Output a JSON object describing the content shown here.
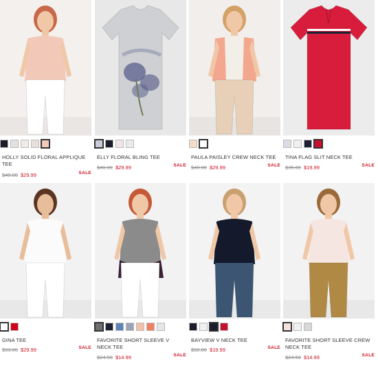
{
  "products": [
    {
      "name": "HOLLY SOLID FLORAL APPLIQUE TEE",
      "old_price": "$40.00",
      "price": "$29.99",
      "sale": "SALE",
      "swatches": [
        "#1c1c2a",
        "#e2e2e2",
        "#f0ebe6",
        "#e9e0db",
        "#f2c9b8"
      ],
      "selected_swatch": 4,
      "colors": {
        "bg": "#f3f0ee",
        "top": "#f2c9b8",
        "bottom": "#ffffff",
        "skin": "#f0c8a8",
        "hair": "#c8684a"
      }
    },
    {
      "name": "ELLY FLORAL BLING TEE",
      "old_price": "$40.00",
      "price": "$29.99",
      "sale": "SALE",
      "swatches": [
        "#c9ccd8",
        "#1c1c2a",
        "#f2e4e4",
        "#ebebeb"
      ],
      "selected_swatch": 0,
      "colors": {
        "bg": "#e8e8e8",
        "top": "#cfd0d3",
        "bottom": "#cfd0d3",
        "skin": "#cfd0d3",
        "hair": "#cfd0d3",
        "print": "#5a5f8c"
      }
    },
    {
      "name": "PAULA PAISLEY CREW NECK TEE",
      "old_price": "$40.00",
      "price": "$29.99",
      "sale": "SALE",
      "swatches": [
        "#f4ddca",
        "#ffffff"
      ],
      "selected_swatch": 1,
      "colors": {
        "bg": "#f1eeec",
        "top": "#f2efe9",
        "bottom": "#e7cfb8",
        "skin": "#f0c8a8",
        "hair": "#d3a266",
        "cardigan": "#f3a78f"
      }
    },
    {
      "name": "TINA FLAG SLIT NECK TEE",
      "old_price": "$35.00",
      "price": "$19.99",
      "sale": "SALE",
      "swatches": [
        "#d8dce3",
        "#f0f0f0",
        "#1c2233",
        "#c8102e"
      ],
      "selected_swatch": 3,
      "colors": {
        "bg": "#ececec",
        "top": "#d81c3c",
        "bottom": "#d81c3c",
        "skin": "#d81c3c",
        "hair": "#d81c3c"
      }
    },
    {
      "name": "GINA TEE",
      "old_price": "$33.00",
      "price": "$29.99",
      "sale": "SALE",
      "swatches": [
        "#ffffff",
        "#d0021b"
      ],
      "selected_swatch": 0,
      "colors": {
        "bg": "#f2f2f2",
        "top": "#fbfbfb",
        "bottom": "#ffffff",
        "skin": "#e8bd9a",
        "hair": "#5a3622"
      }
    },
    {
      "name": "FAVORITE SHORT SLEEVE V NECK TEE",
      "old_price": "$24.50",
      "price": "$14.99",
      "sale": "SALE",
      "swatches": [
        "#6f6f6f",
        "#1c2233",
        "#5d82b8",
        "#9aa5b6",
        "#f2c0a8",
        "#f08060",
        "#e6e6e6"
      ],
      "selected_swatch": 0,
      "colors": {
        "bg": "#f2f2f2",
        "top": "#8b8b8b",
        "bottom": "#ffffff",
        "skin": "#f0c8a8",
        "hair": "#c45a38",
        "sweater": "#3a1f35"
      }
    },
    {
      "name": "BAYVIEW V NECK TEE",
      "old_price": "$32.00",
      "price": "$19.99",
      "sale": "SALE",
      "swatches": [
        "#1c1c2a",
        "#f0f0f0",
        "#1c1c2a",
        "#c8102e"
      ],
      "selected_swatch": 2,
      "colors": {
        "bg": "#f3f3f3",
        "top": "#141a2c",
        "bottom": "#3b5572",
        "skin": "#f0c8a8",
        "hair": "#c9a070"
      }
    },
    {
      "name": "FAVORITE SHORT SLEEVE CREW NECK TEE",
      "old_price": "$24.50",
      "price": "$14.99",
      "sale": "SALE",
      "swatches": [
        "#f4e2dd",
        "#f0f0f0",
        "#d8d8d8"
      ],
      "selected_swatch": 0,
      "colors": {
        "bg": "#f2f2f2",
        "top": "#f6e6e2",
        "bottom": "#b08944",
        "skin": "#f0c8a8",
        "hair": "#9b6a3a"
      }
    }
  ]
}
